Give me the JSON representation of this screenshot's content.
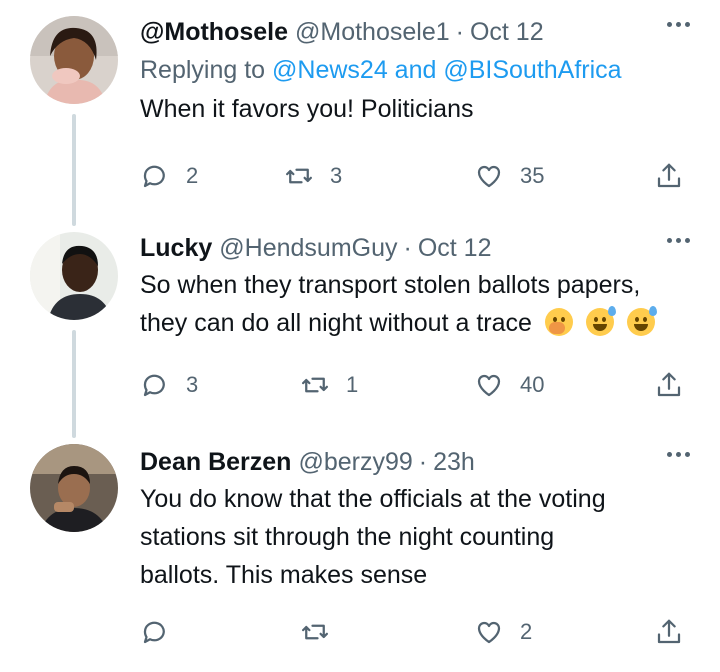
{
  "tweets": [
    {
      "name": "@Mothosele",
      "handle": "@Mothosele1",
      "separator": "·",
      "time": "Oct 12",
      "replying_prefix": "Replying to",
      "replying_to": "@News24 and @BISouthAfrica",
      "text": "When it favors you! Politicians",
      "emojis": [],
      "reply_count": "2",
      "retweet_count": "3",
      "like_count": "35"
    },
    {
      "name": "Lucky",
      "handle": "@HendsumGuy",
      "separator": "·",
      "time": "Oct 12",
      "text_line1": "So when they transport stolen ballots papers,",
      "text_line2": "they can do all night without a trace",
      "emojis": [
        "face-with-hand-over-mouth",
        "grinning-face-with-sweat",
        "grinning-face-with-sweat"
      ],
      "reply_count": "3",
      "retweet_count": "1",
      "like_count": "40"
    },
    {
      "name": "Dean Berzen",
      "handle": "@berzy99",
      "separator": "·",
      "time": "23h",
      "text_line1": "You do know that the officials at the voting",
      "text_line2": "stations sit through the night counting",
      "text_line3": "ballots. This makes sense",
      "emojis": [],
      "reply_count": "",
      "retweet_count": "",
      "like_count": "2"
    }
  ],
  "icons": {
    "reply": "reply-icon",
    "retweet": "retweet-icon",
    "like": "heart-icon",
    "share": "share-icon",
    "more": "more-dots-icon"
  },
  "colors": {
    "text": "#0f1419",
    "secondary": "#536471",
    "link": "#1d9bf0",
    "thread_line": "#cfd9de"
  }
}
